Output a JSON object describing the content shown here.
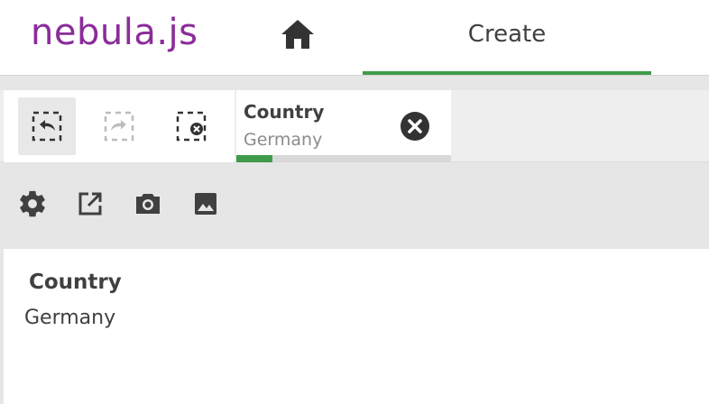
{
  "header": {
    "logo_text": "nebula.js",
    "logo_color": "#8b2c9a",
    "home_icon": "home-icon",
    "tab_label": "Create",
    "tab_active_color": "#3f9b4a"
  },
  "selections": {
    "actions": [
      {
        "name": "step-back",
        "icon": "selection-back-icon",
        "enabled": true
      },
      {
        "name": "step-forward",
        "icon": "selection-forward-icon",
        "enabled": false
      },
      {
        "name": "clear-all",
        "icon": "selection-clear-icon",
        "enabled": true
      }
    ],
    "chip": {
      "field": "Country",
      "value": "Germany",
      "selected_fraction": 0.17,
      "bar_color": "#3f9b4a"
    }
  },
  "toolbar": {
    "items": [
      "settings-icon",
      "open-external-icon",
      "camera-icon",
      "image-icon"
    ]
  },
  "panel": {
    "title": "Country",
    "value": "Germany"
  }
}
